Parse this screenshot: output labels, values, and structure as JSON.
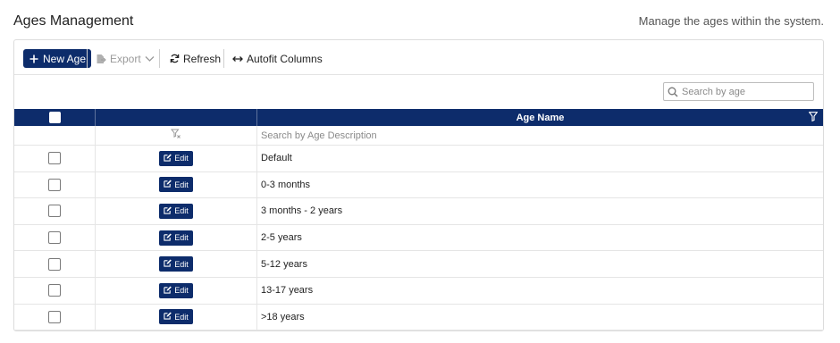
{
  "header": {
    "title": "Ages Management",
    "subtitle": "Manage the ages within the system."
  },
  "toolbar": {
    "new_label": "New Age",
    "export_label": "Export",
    "refresh_label": "Refresh",
    "autofit_label": "Autofit Columns"
  },
  "search": {
    "placeholder": "Search by age"
  },
  "grid": {
    "column_name": "Age Name",
    "filter_placeholder": "Search by Age Description",
    "edit_label": "Edit",
    "rows": [
      {
        "name": "Default"
      },
      {
        "name": "0-3 months"
      },
      {
        "name": "3 months - 2 years"
      },
      {
        "name": "2-5 years"
      },
      {
        "name": "5-12 years"
      },
      {
        "name": "13-17 years"
      },
      {
        "name": ">18 years"
      }
    ]
  },
  "colors": {
    "brand": "#0d2c6b"
  }
}
